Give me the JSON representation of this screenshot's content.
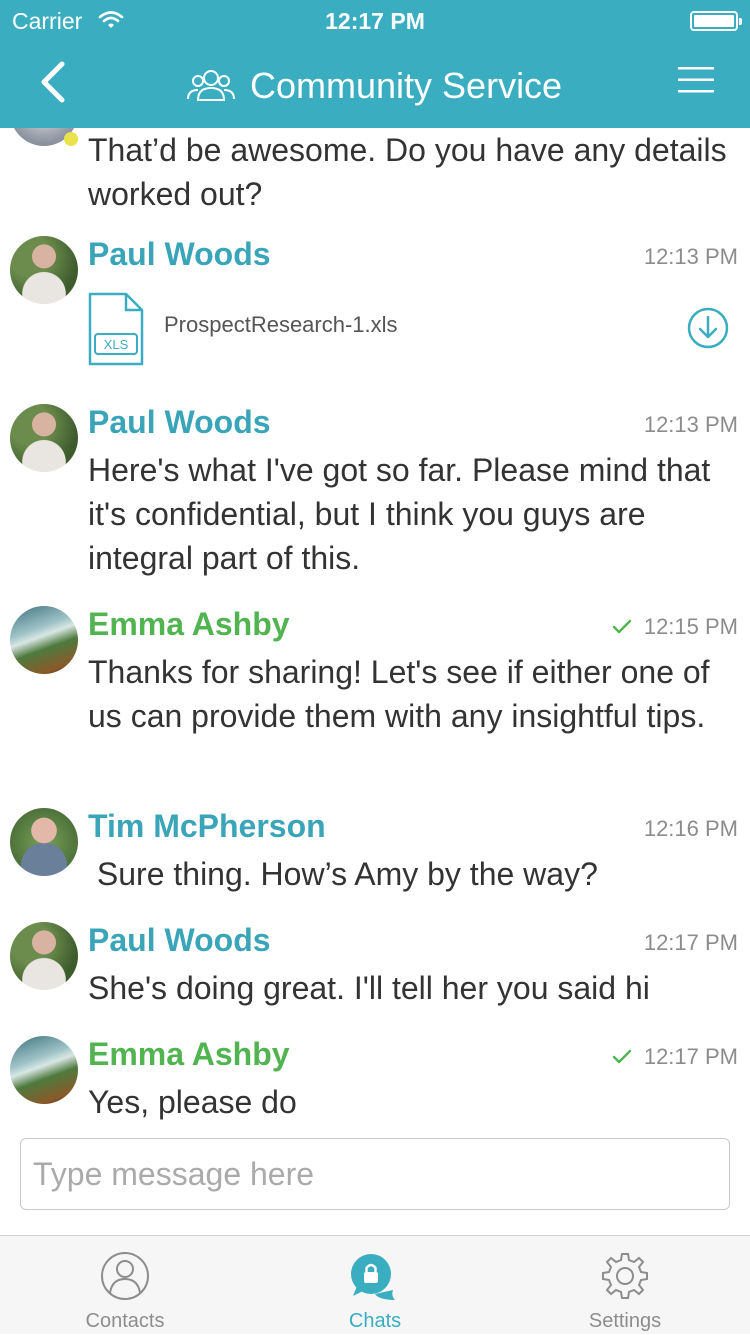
{
  "status_bar": {
    "carrier": "Carrier",
    "time": "12:17 PM"
  },
  "nav": {
    "title": "Community Service",
    "back_icon": "chevron-left-icon",
    "group_icon": "group-icon",
    "menu_icon": "hamburger-menu-icon"
  },
  "colors": {
    "accent": "#3aadc1",
    "blue_name": "#3aa5b8",
    "green_name": "#52b451",
    "timestamp": "#8c8c8c"
  },
  "chat": {
    "partial_text": "That’d be awesome. Do you have any details worked out?",
    "messages": [
      {
        "sender": "Paul Woods",
        "time": "12:13 PM",
        "attachment": {
          "type": "XLS",
          "filename": "ProspectResearch-1.xls"
        }
      },
      {
        "sender": "Paul Woods",
        "time": "12:13 PM",
        "text": "Here's what I've got so far. Please mind that it's confidential, but I think you guys are integral part of this."
      },
      {
        "sender": "Emma Ashby",
        "time": "12:15 PM",
        "read": true,
        "text": "Thanks for sharing! Let's see if either one of us can provide them with any insightful tips."
      },
      {
        "sender": "Tim McPherson",
        "time": "12:16 PM",
        "text": " Sure thing. How’s Amy by the way?"
      },
      {
        "sender": "Paul Woods",
        "time": "12:17 PM",
        "text": "She's doing great. I'll tell her you said hi"
      },
      {
        "sender": "Emma Ashby",
        "time": "12:17 PM",
        "read": true,
        "text": "Yes, please do"
      }
    ]
  },
  "composer": {
    "placeholder": "Type message here",
    "value": ""
  },
  "tabbar": {
    "tabs": [
      {
        "label": "Contacts",
        "icon": "contacts-icon",
        "active": false
      },
      {
        "label": "Chats",
        "icon": "chats-icon",
        "active": true
      },
      {
        "label": "Settings",
        "icon": "gear-icon",
        "active": false
      }
    ]
  }
}
